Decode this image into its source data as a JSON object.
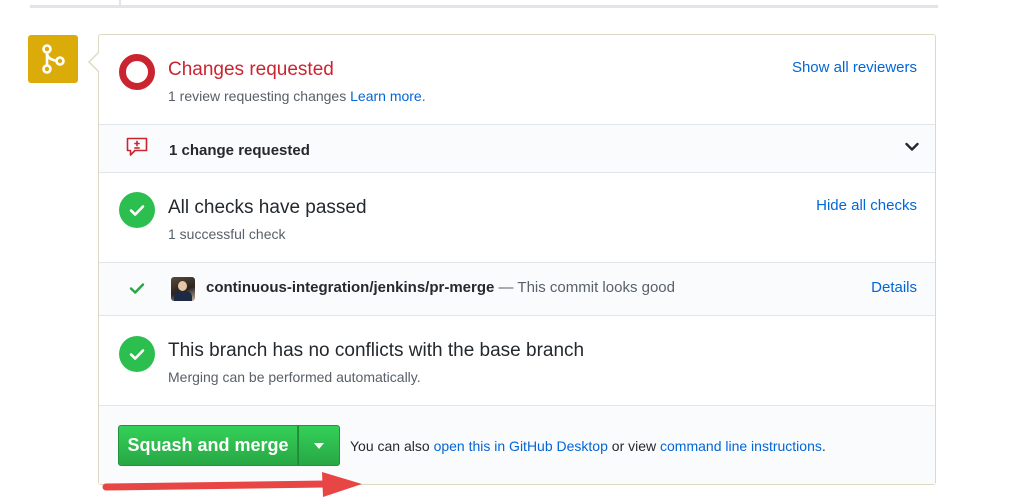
{
  "review": {
    "title": "Changes requested",
    "subtitle": "1 review requesting changes",
    "learn_more": "Learn more",
    "subtitle_end": ".",
    "show_reviewers": "Show all reviewers"
  },
  "requested": {
    "label": "1 change requested"
  },
  "checks": {
    "title": "All checks have passed",
    "subtitle": "1 successful check",
    "hide_checks": "Hide all checks"
  },
  "check_item": {
    "name": "continuous-integration/jenkins/pr-merge",
    "description": " — This commit looks good",
    "details": "Details"
  },
  "conflicts": {
    "title": "This branch has no conflicts with the base branch",
    "subtitle": "Merging can be performed automatically."
  },
  "merge": {
    "button_label": "Squash and merge",
    "alt_prefix": "You can also ",
    "desktop_link": "open this in GitHub Desktop",
    "alt_middle": " or view ",
    "cli_link": "command line instructions",
    "alt_suffix": "."
  },
  "colors": {
    "merge_badge": "#dbab09",
    "changes_red": "#cb2431",
    "success_green": "#2cbe4e",
    "link_blue": "#0366d6",
    "annotation_arrow": "#e84545"
  },
  "icons": {
    "merge_badge": "git-merge-icon",
    "review_status": "changes-requested-icon",
    "request": "request-changes-icon",
    "expand": "chevron-down-icon",
    "checks_status": "check-circle-icon",
    "check_item": "check-icon",
    "conflicts_status": "check-circle-icon",
    "merge_options": "triangle-down-icon"
  }
}
